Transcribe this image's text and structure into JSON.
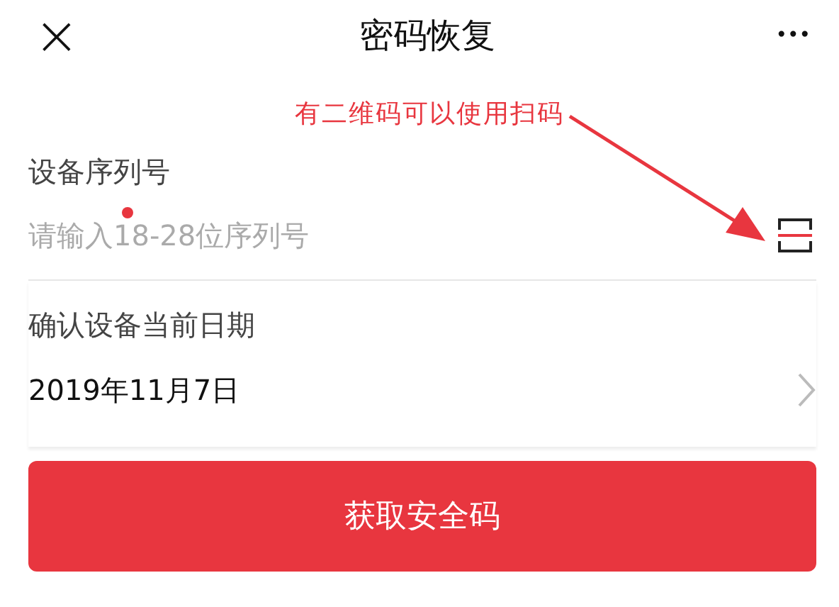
{
  "header": {
    "close_glyph": "×",
    "title": "密码恢复",
    "more_glyph": "•••"
  },
  "annotation": {
    "text": "有二维码可以使用扫码"
  },
  "form": {
    "fields": [
      {
        "kind": "input",
        "label": "设备序列号",
        "placeholder": "请输入18-28位序列号"
      },
      {
        "kind": "picker",
        "label": "确认设备当前日期",
        "value": "2019年11月7日"
      }
    ]
  },
  "submit_button": "获取安全码"
}
